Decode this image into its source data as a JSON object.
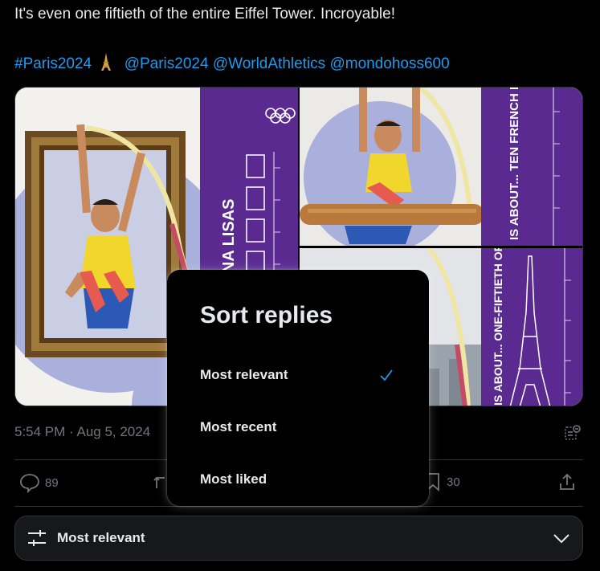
{
  "tweet": {
    "text": "It's even one fiftieth of the entire Eiffel Tower. Incroyable!",
    "hashtag": "#Paris2024",
    "mentions": [
      "@Paris2024",
      "@WorldAthletics",
      "@mondohoss600"
    ],
    "timestamp": "5:54 PM · Aug 5, 2024"
  },
  "media": {
    "images": [
      {
        "banner_text": "EIGHT MONA LISAS",
        "subject": "pole vaulter in golden picture frame"
      },
      {
        "banner_text": "IS ABOUT... TEN FRENCH BAGUETTES",
        "subject": "pole vaulter over baguette"
      },
      {
        "banner_text": "IS ABOUT... ONE-FIFTIETH OF THE EIFFEL TOWER",
        "subject": "pole vaulter beside Eiffel Tower"
      }
    ],
    "brand_purple": "#5a2a91"
  },
  "actions": {
    "replies": "89",
    "likes": "",
    "bookmarks": "30"
  },
  "sort_menu": {
    "title": "Sort replies",
    "options": [
      {
        "label": "Most relevant",
        "selected": true
      },
      {
        "label": "Most recent",
        "selected": false
      },
      {
        "label": "Most liked",
        "selected": false
      }
    ]
  },
  "sort_bar": {
    "label": "Most relevant"
  },
  "colors": {
    "link": "#1d9bf0",
    "muted": "#71767b",
    "text": "#e7e9ea",
    "background": "#000000",
    "surface": "#16181c"
  }
}
